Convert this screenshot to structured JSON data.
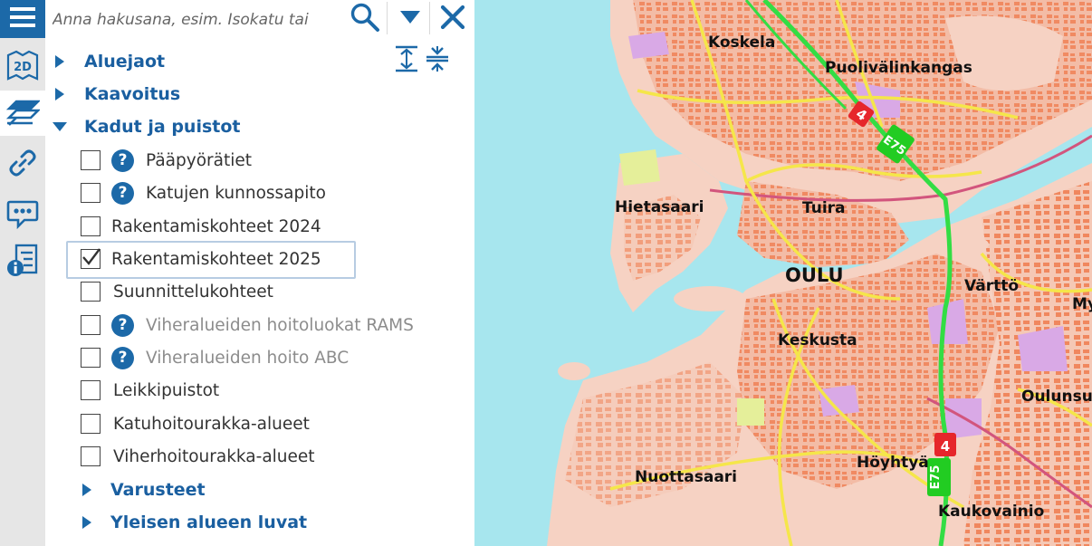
{
  "search": {
    "placeholder": "Anna hakusana, esim. Isokatu tai"
  },
  "rail": {
    "view_mode_label": "2D"
  },
  "tree": {
    "groups": [
      {
        "label": "Aluejaot",
        "expanded": false
      },
      {
        "label": "Kaavoitus",
        "expanded": false
      },
      {
        "label": "Kadut ja puistot",
        "expanded": true
      }
    ],
    "items": [
      {
        "label": "Pääpyörätiet",
        "checked": false,
        "help": true,
        "disabled": false
      },
      {
        "label": "Katujen kunnossapito",
        "checked": false,
        "help": true,
        "disabled": false
      },
      {
        "label": "Rakentamiskohteet 2024",
        "checked": false,
        "help": false,
        "disabled": false
      },
      {
        "label": "Rakentamiskohteet 2025",
        "checked": true,
        "help": false,
        "disabled": false,
        "selected": true
      },
      {
        "label": "Suunnittelukohteet",
        "checked": false,
        "help": false,
        "disabled": false
      },
      {
        "label": "Viheralueiden hoitoluokat RAMS",
        "checked": false,
        "help": true,
        "disabled": true
      },
      {
        "label": "Viheralueiden hoito ABC",
        "checked": false,
        "help": true,
        "disabled": true
      },
      {
        "label": "Leikkipuistot",
        "checked": false,
        "help": false,
        "disabled": false
      },
      {
        "label": "Katuhoitourakka-alueet",
        "checked": false,
        "help": false,
        "disabled": false
      },
      {
        "label": "Viherhoitourakka-alueet",
        "checked": false,
        "help": false,
        "disabled": false
      }
    ],
    "subgroups": [
      {
        "label": "Varusteet",
        "expanded": false
      },
      {
        "label": "Yleisen alueen luvat",
        "expanded": false
      }
    ]
  },
  "map": {
    "places": {
      "koskela": "Koskela",
      "puolivalinkangas": "Puolivälinkangas",
      "hietasaari": "Hietasaari",
      "tuira": "Tuira",
      "oulu": "OULU",
      "vartto": "Värttö",
      "my": "My",
      "keskusta": "Keskusta",
      "oulunsu": "Oulunsu",
      "nuottasaari": "Nuottasaari",
      "hoyhtya": "Höyhtyä",
      "kaukovainio": "Kaukovainio"
    },
    "road_shields": {
      "national": "4",
      "european": "E75"
    },
    "colors": {
      "water": "#a7e6ee",
      "land": "#f6d2c3",
      "urban": "#f0b4a0",
      "buildings": "#f0875e",
      "highway": "#33dd44",
      "main_road": "#f5e64a",
      "rail": "#d2557d"
    }
  },
  "colors": {
    "accent": "#1c69a8",
    "group_label": "#1a5fa0"
  }
}
